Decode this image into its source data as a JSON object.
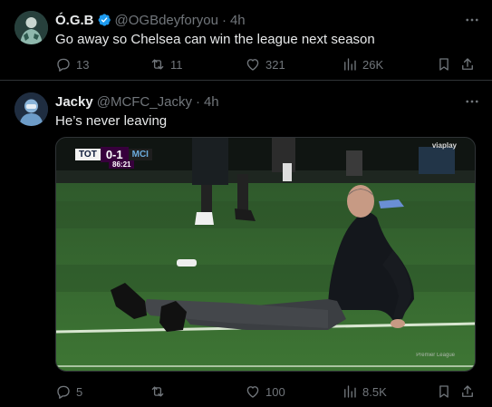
{
  "tweets": [
    {
      "name": "Ó.G.B",
      "verified": true,
      "handle": "@OGBdeyforyou",
      "separator": "·",
      "time": "4h",
      "text": "Go away so Chelsea can win the league next season",
      "replies": "13",
      "retweets": "11",
      "likes": "321",
      "views": "26K"
    },
    {
      "name": "Jacky",
      "verified": false,
      "handle": "@MCFC_Jacky",
      "separator": "·",
      "time": "4h",
      "text": "He’s never leaving",
      "media": {
        "score_home": "TOT",
        "score": "0-1",
        "score_away": "MCI",
        "clock": "86:21",
        "broadcaster": "viaplay",
        "watermark": "Premier League"
      },
      "replies": "5",
      "retweets": "",
      "likes": "100",
      "views": "8.5K"
    }
  ],
  "colors": {
    "background": "#000000",
    "text": "#e7e9ea",
    "muted": "#71767b",
    "verified": "#1d9bf0",
    "divider": "#2f3336"
  },
  "icons": [
    "more-icon",
    "reply-icon",
    "retweet-icon",
    "like-icon",
    "views-icon",
    "bookmark-icon",
    "share-icon",
    "verified-badge-icon"
  ]
}
